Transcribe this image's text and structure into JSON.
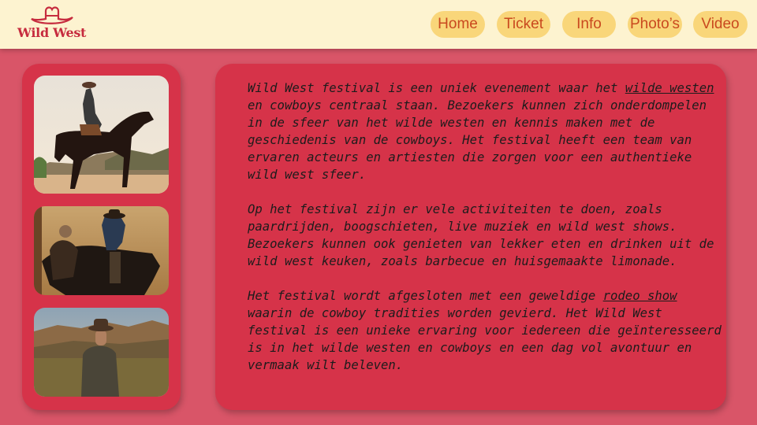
{
  "brand": {
    "logo_text": "Wild West",
    "accent": "#c62b3e",
    "header_bg": "#fdf3d0",
    "page_bg": "#d95568",
    "panel_bg": "#d63349"
  },
  "nav": [
    {
      "label": "Home"
    },
    {
      "label": "Ticket"
    },
    {
      "label": "Info"
    },
    {
      "label": "Photo’s"
    },
    {
      "label": "Video"
    }
  ],
  "photos": [
    {
      "name": "rider-on-horse-desert"
    },
    {
      "name": "cowboys-on-horses-sunset"
    },
    {
      "name": "cowboy-in-field"
    }
  ],
  "content": {
    "p1": {
      "before": "Wild West festival is een uniek evenement waar het ",
      "link": "wilde westen",
      "after": " en cowboys centraal staan. Bezoekers kunnen zich onderdompelen in de sfeer van het wilde westen en kennis maken met de geschiedenis van de cowboys. Het festival heeft een team van ervaren acteurs en artiesten die zorgen voor een authentieke wild west sfeer."
    },
    "p2": "Op het festival zijn er vele activiteiten te doen, zoals paardrijden, boogschieten, live muziek en wild west shows. Bezoekers kunnen ook genieten van lekker eten en drinken uit de wild west keuken, zoals barbecue en huisgemaakte limonade.",
    "p3": {
      "before": "Het festival wordt afgesloten met een geweldige ",
      "link": "rodeo show",
      "after": " waarin de cowboy tradities worden gevierd. Het Wild West festival is een unieke ervaring voor iedereen die geïnteresseerd is in het wilde westen en cowboys en een dag vol avontuur en vermaak wilt beleven."
    }
  }
}
